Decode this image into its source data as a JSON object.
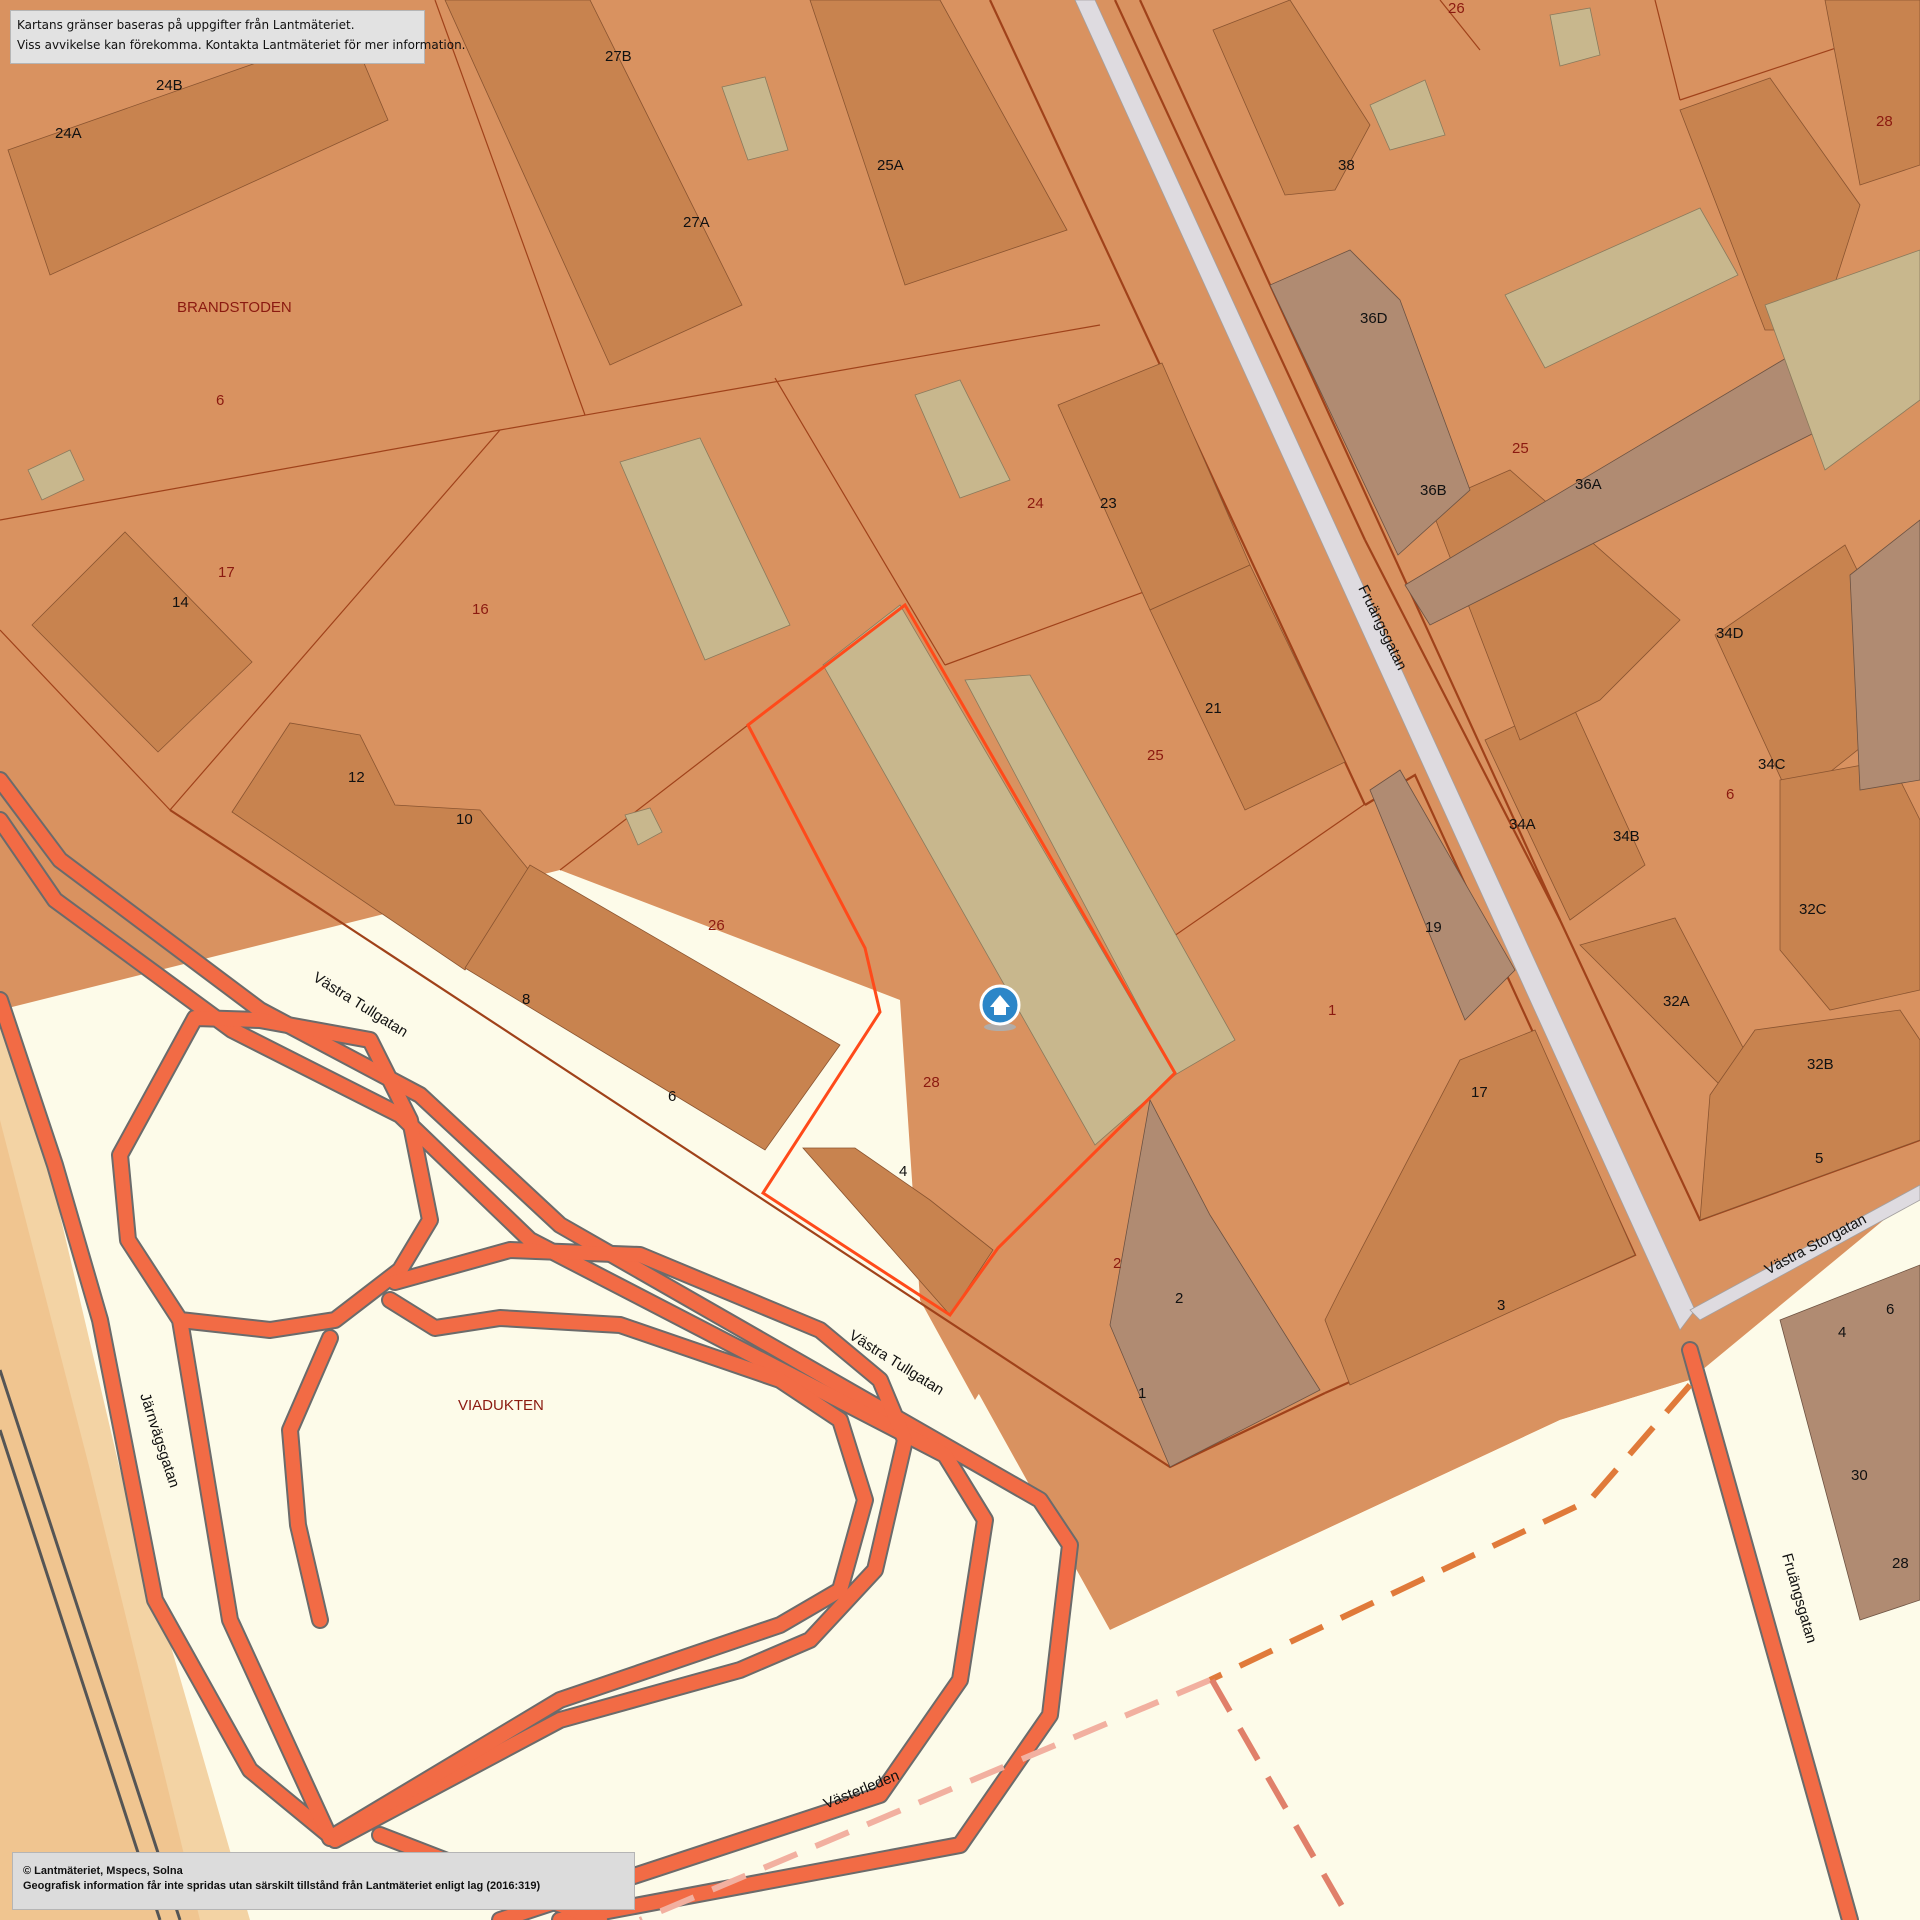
{
  "disclaimer": {
    "line1": "Kartans gränser baseras på uppgifter från Lantmäteriet.",
    "line2": "Viss avvikelse kan förekomma. Kontakta Lantmäteriet för mer information."
  },
  "copyright": {
    "line1": "© Lantmäteriet, Mspecs, Solna",
    "line2": "Geografisk information får inte spridas utan särskilt tillstånd från Lantmäteriet enligt lag (2016:319)"
  },
  "areas": {
    "brandstoden": "BRANDSTODEN",
    "viadukten": "VIADUKTEN"
  },
  "streets": {
    "fruangsgatan": "Fruängsgatan",
    "fruangsgatan2": "Fruängsgatan",
    "vastra_tullgatan_1": "Västra Tullgatan",
    "vastra_tullgatan_2": "Västra Tullgatan",
    "vastra_storgatan": "Västra Storgatan",
    "jarnvagsgatan": "Järnvägsgatan",
    "vasterleden": "Västerleden"
  },
  "parcels": {
    "p26_top": "26",
    "p28_topright": "28",
    "p6_left": "6",
    "p17": "17",
    "p16": "16",
    "p24": "24",
    "p25_right": "25",
    "p25_mid": "25",
    "p26_mid": "26",
    "p28_selected": "28",
    "p1": "1",
    "p2": "2",
    "p6_right": "6"
  },
  "buildings": {
    "b27B": "27B",
    "b24B": "24B",
    "b24A": "24A",
    "b25A": "25A",
    "b27A": "27A",
    "b38": "38",
    "b36D": "36D",
    "b36B": "36B",
    "b36A": "36A",
    "b23": "23",
    "b14": "14",
    "b21": "21",
    "b34D": "34D",
    "b34C": "34C",
    "b34A": "34A",
    "b34B": "34B",
    "b12": "12",
    "b10": "10",
    "b32C": "32C",
    "b19": "19",
    "b32A": "32A",
    "b8": "8",
    "b32B": "32B",
    "b17": "17",
    "b6": "6",
    "b4": "4",
    "b5": "5",
    "b2": "2",
    "b3": "3",
    "b1": "1",
    "b4r": "4",
    "b6r": "6",
    "b30": "30",
    "b28r": "28"
  },
  "markers": {
    "home": "home-icon"
  },
  "colors": {
    "parcel": "#d99260",
    "building": "#c8834f",
    "building_grey": "#b08b72",
    "yard": "#c8b78d",
    "road": "#f26b45",
    "selection": "#ff4a1a",
    "background": "#fdfbe9"
  }
}
